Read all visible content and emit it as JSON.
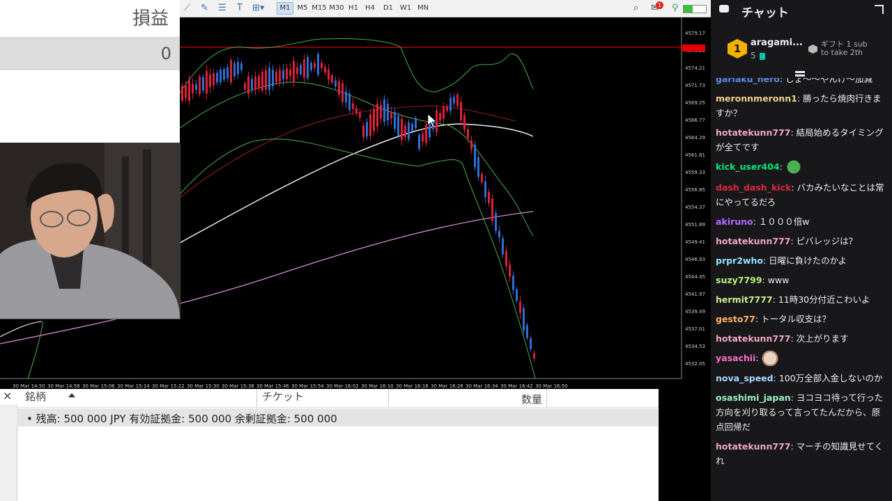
{
  "pl": {
    "title": "損益",
    "value": "0"
  },
  "toolbar": {
    "timeframes": [
      "M1",
      "M5",
      "M15",
      "M30",
      "H1",
      "H4",
      "D1",
      "W1",
      "MN"
    ],
    "active_timeframe": "M1",
    "alert_badge": "1"
  },
  "chart": {
    "price_labels": [
      "4579.17",
      "4576.69",
      "4574.21",
      "4571.73",
      "4569.25",
      "4566.77",
      "4564.29",
      "4561.81",
      "4559.33",
      "4556.85",
      "4554.37",
      "4551.89",
      "4549.41",
      "4546.93",
      "4544.45",
      "4541.97",
      "4539.49",
      "4537.01",
      "4534.53",
      "4532.05"
    ],
    "time_labels": [
      "30 Mar 14:50",
      "30 Mar 14:58",
      "30 Mar 15:06",
      "30 Mar 15:14",
      "30 Mar 15:22",
      "30 Mar 15:30",
      "30 Mar 15:38",
      "30 Mar 15:46",
      "30 Mar 15:54",
      "30 Mar 16:02",
      "30 Mar 16:10",
      "30 Mar 16:18",
      "30 Mar 16:26",
      "30 Mar 16:34",
      "30 Mar 16:42",
      "30 Mar 16:50"
    ],
    "colors": {
      "bull": "#2f6fd6",
      "bear": "#e0203a",
      "bb": "#4caf50",
      "ma_white": "#f0f0f0",
      "ma_pink": "#d98ad8",
      "ma_red": "#7a1a1a",
      "price_line": "#e00000"
    }
  },
  "terminal": {
    "close": "×",
    "col_symbol": "銘柄",
    "col_ticket": "チケット",
    "col_volume": "数量",
    "balance_line": "•  残高: 500 000 JPY  有効証拠金: 500 000  余剰証拠金: 500 000"
  },
  "chat": {
    "title": "チャット",
    "leader": {
      "rank": "1",
      "name": "aragami...",
      "count": "5"
    },
    "gift": {
      "line1": "ギフト 1 sub",
      "line2": "to take 2th"
    },
    "messages": [
      {
        "user": "gariaku_hero",
        "color": "#5b8ee6",
        "text": "しょ～～やんけ～加減"
      },
      {
        "user": "meronnmeronn1",
        "color": "#f0d28c",
        "text": "勝ったら焼肉行きますか？"
      },
      {
        "user": "hotatekunn777",
        "color": "#f2a7c2",
        "text": "結局始めるタイミングが全てです"
      },
      {
        "user": "kick_user404",
        "color": "#00e676",
        "text": "",
        "emote": "pepe"
      },
      {
        "user": "dash_dash_kick",
        "color": "#d6283a",
        "text": "バカみたいなことは常にやってるだろ"
      },
      {
        "user": "akiruno",
        "color": "#b36bff",
        "text": "１０００倍w"
      },
      {
        "user": "hotatekunn777",
        "color": "#f2a7c2",
        "text": "ピバレッジは？"
      },
      {
        "user": "prpr2who",
        "color": "#8fe3ff",
        "text": "日曜に負けたのかよ"
      },
      {
        "user": "suzy7799",
        "color": "#b7f27a",
        "text": "www"
      },
      {
        "user": "hermit7777",
        "color": "#c8f08c",
        "text": "11時30分付近こわいよ"
      },
      {
        "user": "gesto77",
        "color": "#ffb36b",
        "text": "トータル収支は？"
      },
      {
        "user": "hotatekunn777",
        "color": "#f2a7c2",
        "text": "次上がります"
      },
      {
        "user": "yasachii",
        "color": "#ff6ec7",
        "text": "",
        "emote": "cat"
      },
      {
        "user": "nova_speed",
        "color": "#a9d8ff",
        "text": "100万全部入金しないのか"
      },
      {
        "user": "osashimi_japan",
        "color": "#9ef0c0",
        "text": "ヨコヨコ待って行った方向を刈り取るって言ってたんだから、原点回帰だ"
      },
      {
        "user": "hotatekunn777",
        "color": "#f2a7c2",
        "text": "マーチの知識見せてくれ"
      }
    ]
  }
}
